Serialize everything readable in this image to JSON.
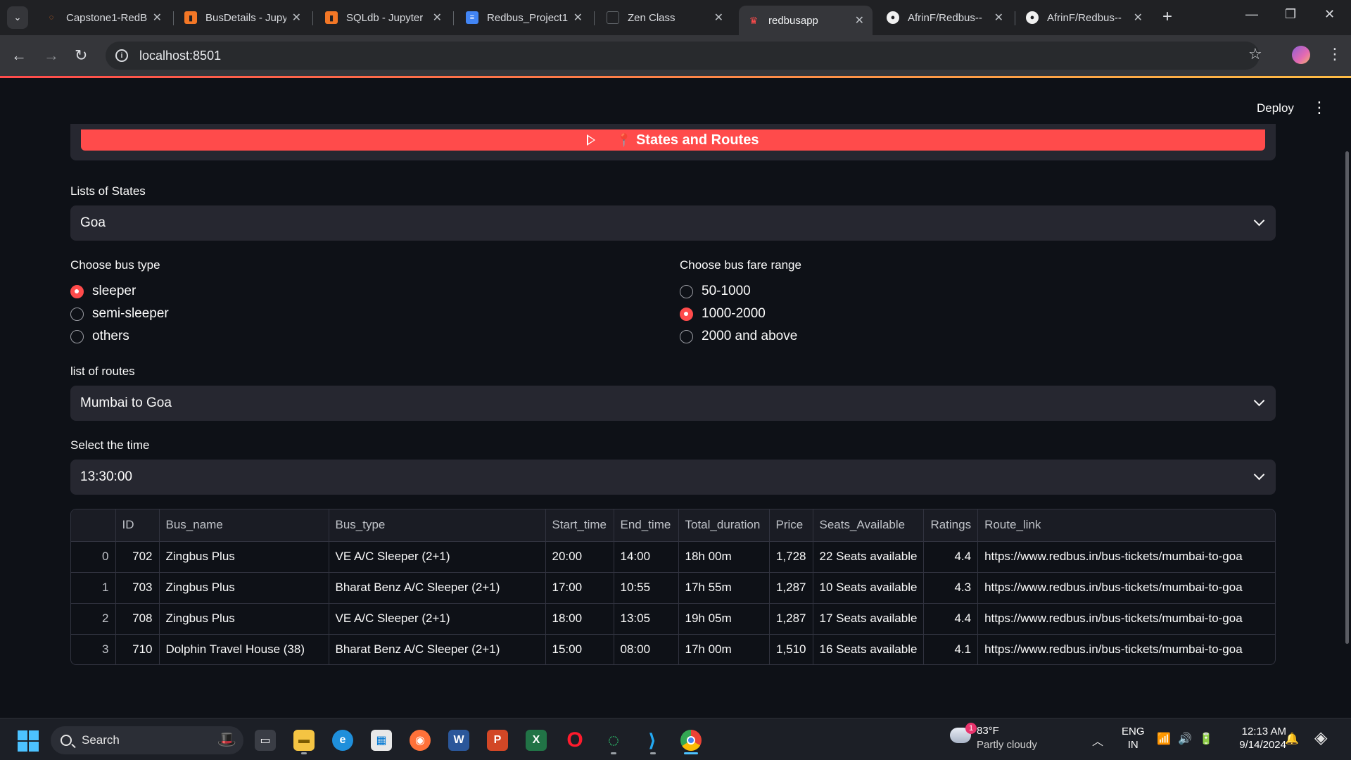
{
  "browser": {
    "tabs": [
      {
        "title": "Capstone1-RedB",
        "favicon": "jupyter-icon",
        "color": "#f37726"
      },
      {
        "title": "BusDetails - Jupy",
        "favicon": "notebook-icon",
        "color": "#f37726"
      },
      {
        "title": "SQLdb - Jupyter",
        "favicon": "notebook-icon",
        "color": "#f37726"
      },
      {
        "title": "Redbus_Project1",
        "favicon": "docs-icon",
        "color": "#4285f4"
      },
      {
        "title": "Zen Class",
        "favicon": "page-icon",
        "color": "#5f6368"
      },
      {
        "title": "redbusapp",
        "favicon": "streamlit-icon",
        "color": "#ff4b4b"
      },
      {
        "title": "AfrinF/Redbus--",
        "favicon": "github-icon",
        "color": "#f0f0f0"
      },
      {
        "title": "AfrinF/Redbus--",
        "favicon": "github-icon",
        "color": "#f0f0f0"
      }
    ],
    "active_tab": 5,
    "url": "localhost:8501"
  },
  "app": {
    "deploy_label": "Deploy",
    "section_button": "States and Routes",
    "states_label": "Lists of States",
    "state_value": "Goa",
    "bus_type_label": "Choose bus type",
    "bus_types": [
      "sleeper",
      "semi-sleeper",
      "others"
    ],
    "bus_type_selected": 0,
    "fare_label": "Choose bus fare range",
    "fares": [
      "50-1000",
      "1000-2000",
      "2000 and above"
    ],
    "fare_selected": 1,
    "routes_label": "list of routes",
    "route_value": "Mumbai to Goa",
    "time_label": "Select the time",
    "time_value": "13:30:00"
  },
  "table": {
    "columns": [
      "",
      "ID",
      "Bus_name",
      "Bus_type",
      "Start_time",
      "End_time",
      "Total_duration",
      "Price",
      "Seats_Available",
      "Ratings",
      "Route_link"
    ],
    "rows": [
      [
        "0",
        "702",
        "Zingbus Plus",
        "VE A/C Sleeper (2+1)",
        "20:00",
        "14:00",
        "18h 00m",
        "1,728",
        "22 Seats available",
        "4.4",
        "https://www.redbus.in/bus-tickets/mumbai-to-goa"
      ],
      [
        "1",
        "703",
        "Zingbus Plus",
        "Bharat Benz A/C Sleeper (2+1)",
        "17:00",
        "10:55",
        "17h 55m",
        "1,287",
        "10 Seats available",
        "4.3",
        "https://www.redbus.in/bus-tickets/mumbai-to-goa"
      ],
      [
        "2",
        "708",
        "Zingbus Plus",
        "VE A/C Sleeper (2+1)",
        "18:00",
        "13:05",
        "19h 05m",
        "1,287",
        "17 Seats available",
        "4.4",
        "https://www.redbus.in/bus-tickets/mumbai-to-goa"
      ],
      [
        "3",
        "710",
        "Dolphin Travel House (38)",
        "Bharat Benz A/C Sleeper (2+1)",
        "15:00",
        "08:00",
        "17h 00m",
        "1,510",
        "16 Seats available",
        "4.1",
        "https://www.redbus.in/bus-tickets/mumbai-to-goa"
      ]
    ]
  },
  "taskbar": {
    "search": "Search",
    "weather_temp": "83°F",
    "weather_cond": "Partly cloudy",
    "weather_badge": "1",
    "lang1": "ENG",
    "lang2": "IN",
    "time": "12:13 AM",
    "date": "9/14/2024"
  },
  "colors": {
    "accent": "#ff4b4b",
    "background": "#0e1117",
    "widget": "#262730"
  }
}
